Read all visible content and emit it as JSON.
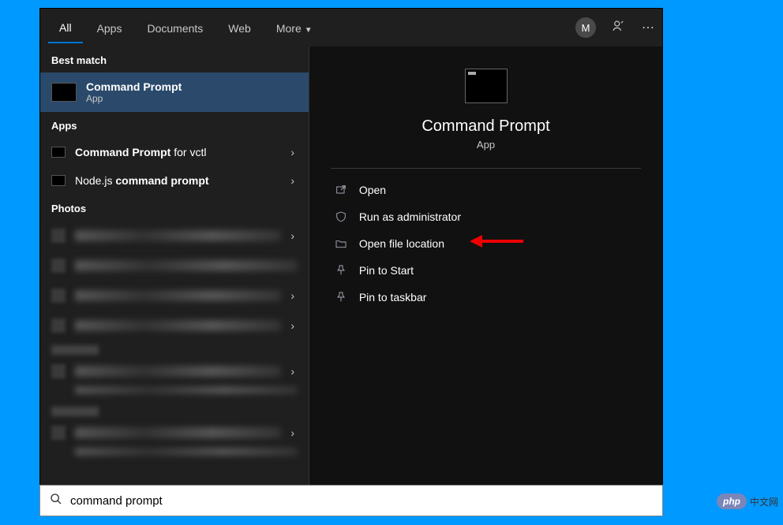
{
  "tabs": {
    "all": "All",
    "apps": "Apps",
    "documents": "Documents",
    "web": "Web",
    "more": "More"
  },
  "avatar_letter": "M",
  "sections": {
    "best_match": "Best match",
    "apps": "Apps",
    "photos": "Photos"
  },
  "best_match": {
    "title": "Command Prompt",
    "subtitle": "App"
  },
  "app_results": {
    "r1_bold": "Command Prompt",
    "r1_rest": " for vctl",
    "r2_pre": "Node.js ",
    "r2_bold": "command prompt"
  },
  "detail": {
    "title": "Command Prompt",
    "subtitle": "App"
  },
  "actions": {
    "open": "Open",
    "run_admin": "Run as administrator",
    "open_loc": "Open file location",
    "pin_start": "Pin to Start",
    "pin_taskbar": "Pin to taskbar"
  },
  "search": {
    "value": "command prompt"
  },
  "watermark": {
    "php": "php",
    "cn": "中文网"
  }
}
